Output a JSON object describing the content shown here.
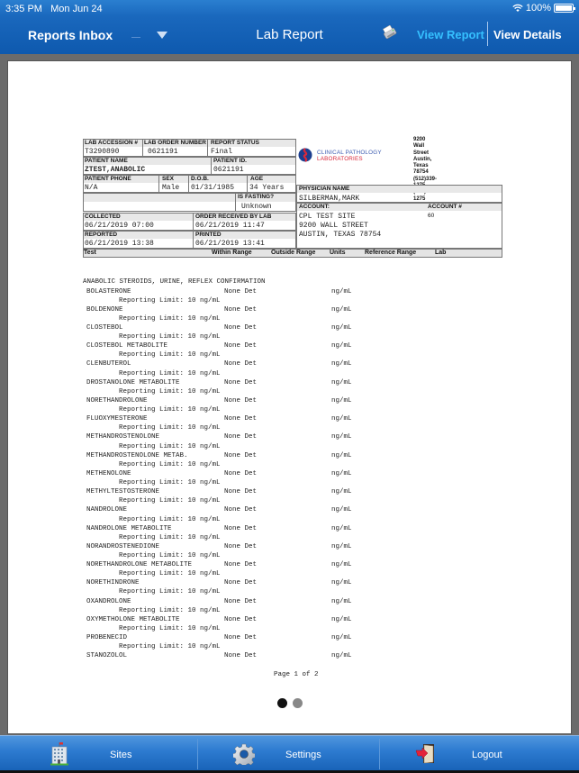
{
  "status_bar": {
    "time": "3:35 PM",
    "date": "Mon Jun 24",
    "battery": "100%"
  },
  "nav": {
    "left_label": "Reports Inbox",
    "title": "Lab Report",
    "view_report": "View Report",
    "view_details": "View Details",
    "icons": {
      "dropdown": "chevron-down-icon",
      "print": "printer-icon"
    }
  },
  "report": {
    "header_fields": {
      "lab_accession_label": "LAB ACCESSION #",
      "lab_accession": "T3290890",
      "lab_order_label": "LAB ORDER NUMBER",
      "lab_order": "0621191",
      "report_status_label": "REPORT STATUS",
      "report_status": "Final",
      "patient_name_label": "PATIENT NAME",
      "patient_name": "ZTEST,ANABOLIC",
      "patient_id_label": "PATIENT ID.",
      "patient_id": "0621191",
      "patient_phone_label": "PATIENT PHONE",
      "patient_phone": "N/A",
      "sex_label": "SEX",
      "sex": "Male",
      "dob_label": "D.O.B.",
      "dob": "01/31/1985",
      "age_label": "AGE",
      "age": "34 Years",
      "fasting_label": "IS FASTING?",
      "fasting": "Unknown",
      "collected_label": "COLLECTED",
      "collected": "06/21/2019 07:00",
      "received_label": "ORDER RECEIVED BY LAB",
      "received": "06/21/2019 11:47",
      "reported_label": "REPORTED",
      "reported": "06/21/2019 13:38",
      "printed_label": "PRINTED",
      "printed": "06/21/2019 13:41",
      "physician_label": "PHYSICIAN NAME",
      "physician": "SILBERMAN,MARK",
      "account_label": "ACCOUNT:",
      "account_num_label": "ACCOUNT #",
      "account_num": "60",
      "account_line1": "CPL TEST SITE",
      "account_line2": "9200 WALL STREET",
      "account_line3": "AUSTIN, TEXAS 78754"
    },
    "lab": {
      "name_line1": "CLINICAL PATHOLOGY",
      "name_line2": "LABORATORIES",
      "address1": "9200 Wall Street",
      "address2": "Austin, Texas 78754",
      "phone1": "(512)339-1275",
      "phone2": "(512)339-1275",
      "color_blue": "#1d3f8f",
      "color_red": "#d9283a"
    },
    "columns": {
      "test": "Test",
      "within": "Within Range",
      "outside": "Outside Range",
      "units": "Units",
      "reference": "Reference Range",
      "lab": "Lab"
    },
    "panel_title": "ANABOLIC STEROIDS, URINE, REFLEX CONFIRMATION",
    "results": [
      {
        "name": "BOLASTERONE",
        "result": "None Det",
        "units": "ng/mL",
        "note": "Reporting Limit: 10 ng/mL"
      },
      {
        "name": "BOLDENONE",
        "result": "None Det",
        "units": "ng/mL",
        "note": "Reporting Limit: 10 ng/mL"
      },
      {
        "name": "CLOSTEBOL",
        "result": "None Det",
        "units": "ng/mL",
        "note": "Reporting Limit: 10 ng/mL"
      },
      {
        "name": "CLOSTEBOL METABOLITE",
        "result": "None Det",
        "units": "ng/mL",
        "note": "Reporting Limit: 10 ng/mL"
      },
      {
        "name": "CLENBUTEROL",
        "result": "None Det",
        "units": "ng/mL",
        "note": "Reporting Limit: 10 ng/mL"
      },
      {
        "name": "DROSTANOLONE METABOLITE",
        "result": "None Det",
        "units": "ng/mL",
        "note": "Reporting Limit: 10 ng/mL"
      },
      {
        "name": "NORETHANDROLONE",
        "result": "None Det",
        "units": "ng/mL",
        "note": "Reporting Limit: 10 ng/mL"
      },
      {
        "name": "FLUOXYMESTERONE",
        "result": "None Det",
        "units": "ng/mL",
        "note": "Reporting Limit: 10 ng/mL"
      },
      {
        "name": "METHANDROSTENOLONE",
        "result": "None Det",
        "units": "ng/mL",
        "note": "Reporting Limit: 10 ng/mL"
      },
      {
        "name": "METHANDROSTENOLONE METAB.",
        "result": "None Det",
        "units": "ng/mL",
        "note": "Reporting Limit: 10 ng/mL"
      },
      {
        "name": "METHENOLONE",
        "result": "None Det",
        "units": "ng/mL",
        "note": "Reporting Limit: 10 ng/mL"
      },
      {
        "name": "METHYLTESTOSTERONE",
        "result": "None Det",
        "units": "ng/mL",
        "note": "Reporting Limit: 10 ng/mL"
      },
      {
        "name": "NANDROLONE",
        "result": "None Det",
        "units": "ng/mL",
        "note": "Reporting Limit: 10 ng/mL"
      },
      {
        "name": "NANDROLONE METABOLITE",
        "result": "None Det",
        "units": "ng/mL",
        "note": "Reporting Limit: 10 ng/mL"
      },
      {
        "name": "NORANDROSTENEDIONE",
        "result": "None Det",
        "units": "ng/mL",
        "note": "Reporting Limit: 10 ng/mL"
      },
      {
        "name": "NORETHANDROLONE METABOLITE",
        "result": "None Det",
        "units": "ng/mL",
        "note": "Reporting Limit: 10 ng/mL"
      },
      {
        "name": "NORETHINDRONE",
        "result": "None Det",
        "units": "ng/mL",
        "note": "Reporting Limit: 10 ng/mL"
      },
      {
        "name": "OXANDROLONE",
        "result": "None Det",
        "units": "ng/mL",
        "note": "Reporting Limit: 10 ng/mL"
      },
      {
        "name": "OXYMETHOLONE METABOLITE",
        "result": "None Det",
        "units": "ng/mL",
        "note": "Reporting Limit: 10 ng/mL"
      },
      {
        "name": "PROBENECID",
        "result": "None Det",
        "units": "ng/mL",
        "note": "Reporting Limit: 10 ng/mL"
      },
      {
        "name": "STANOZOLOL",
        "result": "None Det",
        "units": "ng/mL",
        "note": ""
      }
    ],
    "page_indicator": "Page 1 of 2"
  },
  "pager": {
    "total": 2,
    "current": 1,
    "active_color": "#111111",
    "inactive_color": "#888888"
  },
  "tabbar": {
    "items": [
      {
        "label": "Sites",
        "icon": "building-icon"
      },
      {
        "label": "Settings",
        "icon": "gear-icon"
      },
      {
        "label": "Logout",
        "icon": "logout-door-icon"
      }
    ]
  }
}
